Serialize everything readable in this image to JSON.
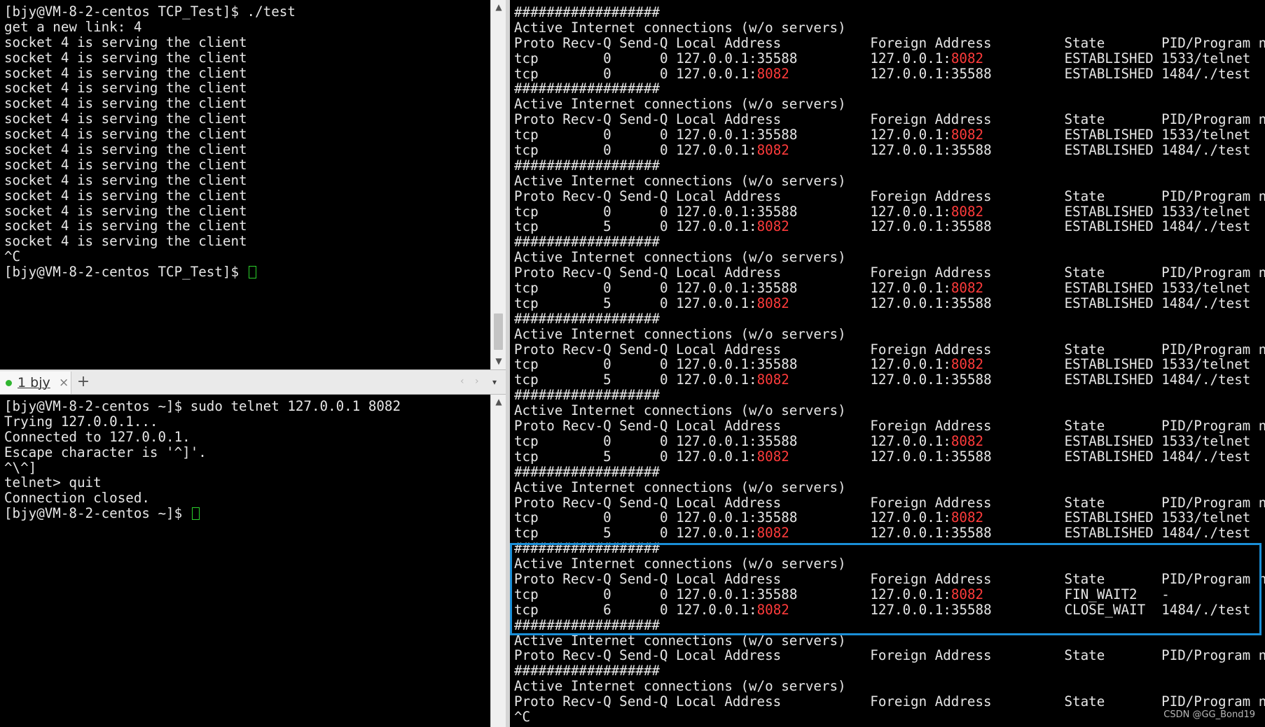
{
  "top_terminal": {
    "lines": [
      "[bjy@VM-8-2-centos TCP_Test]$ ./test",
      "get a new link: 4",
      "socket 4 is serving the client",
      "socket 4 is serving the client",
      "socket 4 is serving the client",
      "socket 4 is serving the client",
      "socket 4 is serving the client",
      "socket 4 is serving the client",
      "socket 4 is serving the client",
      "socket 4 is serving the client",
      "socket 4 is serving the client",
      "socket 4 is serving the client",
      "socket 4 is serving the client",
      "socket 4 is serving the client",
      "socket 4 is serving the client",
      "socket 4 is serving the client",
      "^C"
    ],
    "prompt": "[bjy@VM-8-2-centos TCP_Test]$ "
  },
  "tabbar": {
    "tab_label": "1 bjy",
    "tab_close": "×",
    "add_tab": "+",
    "nav_left": "‹",
    "nav_right": "›",
    "menu": "▾"
  },
  "bottom_terminal": {
    "lines": [
      "[bjy@VM-8-2-centos ~]$ sudo telnet 127.0.0.1 8082",
      "Trying 127.0.0.1...",
      "Connected to 127.0.0.1.",
      "Escape character is '^]'.",
      "^\\^]",
      "telnet> quit",
      "Connection closed."
    ],
    "prompt": "[bjy@VM-8-2-centos ~]$ "
  },
  "netstat": {
    "separator": "##################",
    "title": "Active Internet connections (w/o servers)",
    "header": "Proto Recv-Q Send-Q Local Address           Foreign Address         State       PID/Program name",
    "blocks": [
      {
        "rows": [
          {
            "proto": "tcp",
            "recv": "0",
            "send": "0",
            "local_ip": "127.0.0.1:",
            "local_port": "35588",
            "local_red": false,
            "foreign_ip": "127.0.0.1:",
            "foreign_port": "8082",
            "foreign_red": true,
            "state": "ESTABLISHED",
            "pid": "1533/telnet"
          },
          {
            "proto": "tcp",
            "recv": "0",
            "send": "0",
            "local_ip": "127.0.0.1:",
            "local_port": "8082",
            "local_red": true,
            "foreign_ip": "127.0.0.1:",
            "foreign_port": "35588",
            "foreign_red": false,
            "state": "ESTABLISHED",
            "pid": "1484/./test"
          }
        ]
      },
      {
        "rows": [
          {
            "proto": "tcp",
            "recv": "0",
            "send": "0",
            "local_ip": "127.0.0.1:",
            "local_port": "35588",
            "local_red": false,
            "foreign_ip": "127.0.0.1:",
            "foreign_port": "8082",
            "foreign_red": true,
            "state": "ESTABLISHED",
            "pid": "1533/telnet"
          },
          {
            "proto": "tcp",
            "recv": "0",
            "send": "0",
            "local_ip": "127.0.0.1:",
            "local_port": "8082",
            "local_red": true,
            "foreign_ip": "127.0.0.1:",
            "foreign_port": "35588",
            "foreign_red": false,
            "state": "ESTABLISHED",
            "pid": "1484/./test"
          }
        ]
      },
      {
        "rows": [
          {
            "proto": "tcp",
            "recv": "0",
            "send": "0",
            "local_ip": "127.0.0.1:",
            "local_port": "35588",
            "local_red": false,
            "foreign_ip": "127.0.0.1:",
            "foreign_port": "8082",
            "foreign_red": true,
            "state": "ESTABLISHED",
            "pid": "1533/telnet"
          },
          {
            "proto": "tcp",
            "recv": "5",
            "send": "0",
            "local_ip": "127.0.0.1:",
            "local_port": "8082",
            "local_red": true,
            "foreign_ip": "127.0.0.1:",
            "foreign_port": "35588",
            "foreign_red": false,
            "state": "ESTABLISHED",
            "pid": "1484/./test"
          }
        ]
      },
      {
        "rows": [
          {
            "proto": "tcp",
            "recv": "0",
            "send": "0",
            "local_ip": "127.0.0.1:",
            "local_port": "35588",
            "local_red": false,
            "foreign_ip": "127.0.0.1:",
            "foreign_port": "8082",
            "foreign_red": true,
            "state": "ESTABLISHED",
            "pid": "1533/telnet"
          },
          {
            "proto": "tcp",
            "recv": "5",
            "send": "0",
            "local_ip": "127.0.0.1:",
            "local_port": "8082",
            "local_red": true,
            "foreign_ip": "127.0.0.1:",
            "foreign_port": "35588",
            "foreign_red": false,
            "state": "ESTABLISHED",
            "pid": "1484/./test"
          }
        ]
      },
      {
        "rows": [
          {
            "proto": "tcp",
            "recv": "0",
            "send": "0",
            "local_ip": "127.0.0.1:",
            "local_port": "35588",
            "local_red": false,
            "foreign_ip": "127.0.0.1:",
            "foreign_port": "8082",
            "foreign_red": true,
            "state": "ESTABLISHED",
            "pid": "1533/telnet"
          },
          {
            "proto": "tcp",
            "recv": "5",
            "send": "0",
            "local_ip": "127.0.0.1:",
            "local_port": "8082",
            "local_red": true,
            "foreign_ip": "127.0.0.1:",
            "foreign_port": "35588",
            "foreign_red": false,
            "state": "ESTABLISHED",
            "pid": "1484/./test"
          }
        ]
      },
      {
        "rows": [
          {
            "proto": "tcp",
            "recv": "0",
            "send": "0",
            "local_ip": "127.0.0.1:",
            "local_port": "35588",
            "local_red": false,
            "foreign_ip": "127.0.0.1:",
            "foreign_port": "8082",
            "foreign_red": true,
            "state": "ESTABLISHED",
            "pid": "1533/telnet"
          },
          {
            "proto": "tcp",
            "recv": "5",
            "send": "0",
            "local_ip": "127.0.0.1:",
            "local_port": "8082",
            "local_red": true,
            "foreign_ip": "127.0.0.1:",
            "foreign_port": "35588",
            "foreign_red": false,
            "state": "ESTABLISHED",
            "pid": "1484/./test"
          }
        ]
      },
      {
        "rows": [
          {
            "proto": "tcp",
            "recv": "0",
            "send": "0",
            "local_ip": "127.0.0.1:",
            "local_port": "35588",
            "local_red": false,
            "foreign_ip": "127.0.0.1:",
            "foreign_port": "8082",
            "foreign_red": true,
            "state": "ESTABLISHED",
            "pid": "1533/telnet"
          },
          {
            "proto": "tcp",
            "recv": "5",
            "send": "0",
            "local_ip": "127.0.0.1:",
            "local_port": "8082",
            "local_red": true,
            "foreign_ip": "127.0.0.1:",
            "foreign_port": "35588",
            "foreign_red": false,
            "state": "ESTABLISHED",
            "pid": "1484/./test"
          }
        ]
      },
      {
        "highlighted": true,
        "rows": [
          {
            "proto": "tcp",
            "recv": "0",
            "send": "0",
            "local_ip": "127.0.0.1:",
            "local_port": "35588",
            "local_red": false,
            "foreign_ip": "127.0.0.1:",
            "foreign_port": "8082",
            "foreign_red": true,
            "state": "FIN_WAIT2",
            "pid": "-"
          },
          {
            "proto": "tcp",
            "recv": "6",
            "send": "0",
            "local_ip": "127.0.0.1:",
            "local_port": "8082",
            "local_red": true,
            "foreign_ip": "127.0.0.1:",
            "foreign_port": "35588",
            "foreign_red": false,
            "state": "CLOSE_WAIT",
            "pid": "1484/./test"
          }
        ]
      },
      {
        "rows": []
      },
      {
        "rows": []
      }
    ],
    "end_line": "^C"
  },
  "highlight_color": "#1a8fd8",
  "port_color": "#ff3b3b",
  "cursor_color": "#2bd12b",
  "watermark": "CSDN @GG_Bond19"
}
